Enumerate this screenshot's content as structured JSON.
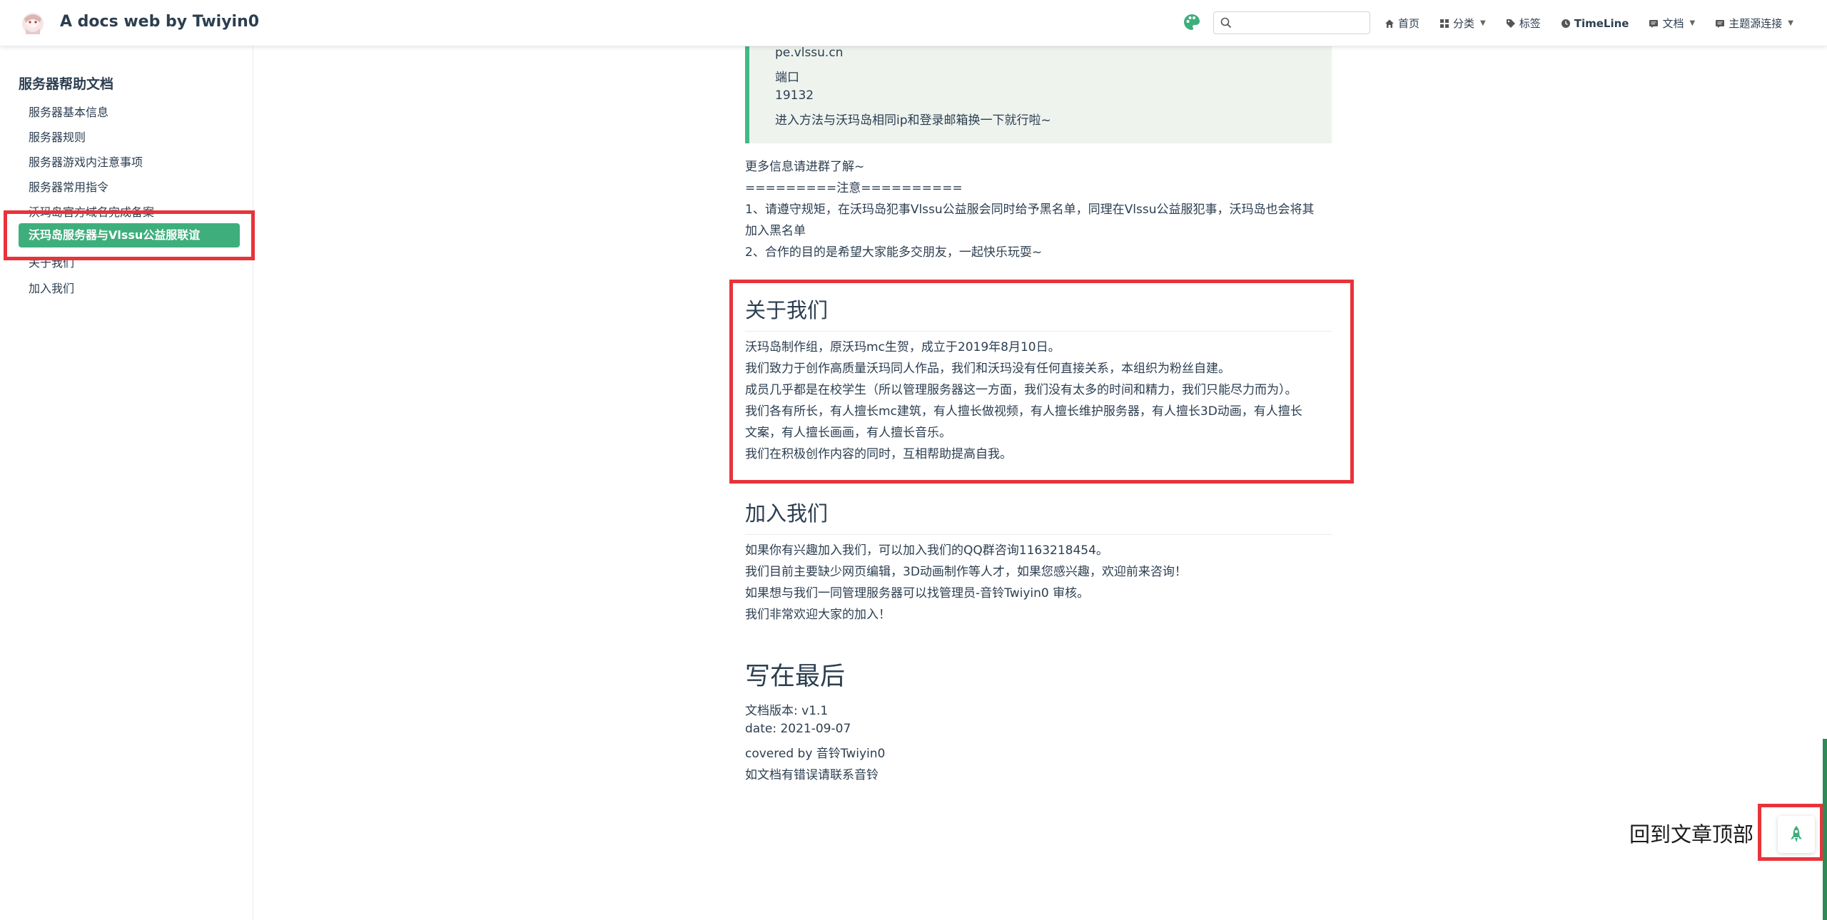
{
  "navbar": {
    "title": "A docs web by Twiyin0",
    "search_placeholder": "",
    "links": [
      {
        "label": "首页",
        "icon": "home-icon"
      },
      {
        "label": "分类",
        "icon": "category-icon",
        "dropdown": true
      },
      {
        "label": "标签",
        "icon": "tag-icon"
      },
      {
        "label": "TimeLine",
        "icon": "clock-icon"
      },
      {
        "label": "文档",
        "icon": "doc-icon",
        "dropdown": true
      },
      {
        "label": "主题源连接",
        "icon": "link-icon",
        "dropdown": true
      }
    ]
  },
  "sidebar": {
    "heading": "服务器帮助文档",
    "items": [
      {
        "label": "服务器基本信息"
      },
      {
        "label": "服务器规则"
      },
      {
        "label": "服务器游戏内注意事项"
      },
      {
        "label": "服务器常用指令"
      },
      {
        "label": "沃玛岛官方域名完成备案"
      },
      {
        "label": "沃玛岛服务器与Vlssu公益服联谊",
        "active": true
      },
      {
        "label": "关于我们"
      },
      {
        "label": "加入我们"
      }
    ]
  },
  "blockquote": {
    "lines": [
      "pe.vlssu.cn",
      "端口",
      "19132",
      "进入方法与沃玛岛相同ip和登录邮箱换一下就行啦~"
    ]
  },
  "notice": {
    "lines": [
      "更多信息请进群了解~",
      "=========注意==========",
      "1、请遵守规矩，在沃玛岛犯事Vlssu公益服会同时给予黑名单，同理在Vlssu公益服犯事，沃玛岛也会将其",
      "加入黑名单",
      "2、合作的目的是希望大家能多交朋友，一起快乐玩耍~"
    ]
  },
  "about": {
    "title": "关于我们",
    "lines": [
      "沃玛岛制作组，原沃玛mc生贺，成立于2019年8月10日。",
      "我们致力于创作高质量沃玛同人作品，我们和沃玛没有任何直接关系，本组织为粉丝自建。",
      "成员几乎都是在校学生（所以管理服务器这一方面，我们没有太多的时间和精力，我们只能尽力而为）。",
      "我们各有所长，有人擅长mc建筑，有人擅长做视频，有人擅长维护服务器，有人擅长3D动画，有人擅长",
      "文案，有人擅长画画，有人擅长音乐。",
      "我们在积极创作内容的同时，互相帮助提高自我。"
    ]
  },
  "join": {
    "title": "加入我们",
    "lines": [
      "如果你有兴趣加入我们，可以加入我们的QQ群咨询1163218454。",
      "我们目前主要缺少网页编辑，3D动画制作等人才，如果您感兴趣，欢迎前来咨询！",
      "如果想与我们一同管理服务器可以找管理员-音铃Twiyin0 审核。",
      "我们非常欢迎大家的加入！"
    ]
  },
  "final": {
    "title": "写在最后",
    "lines": [
      "文档版本: v1.1",
      "date: 2021-09-07",
      "covered by 音铃Twiyin0",
      "如文档有错误请联系音铃"
    ]
  },
  "back_to_top": {
    "label": "回到文章顶部",
    "icon": "rocket-icon"
  },
  "colors": {
    "accent": "#3eaf7c",
    "highlight_box": "#e8333a"
  }
}
